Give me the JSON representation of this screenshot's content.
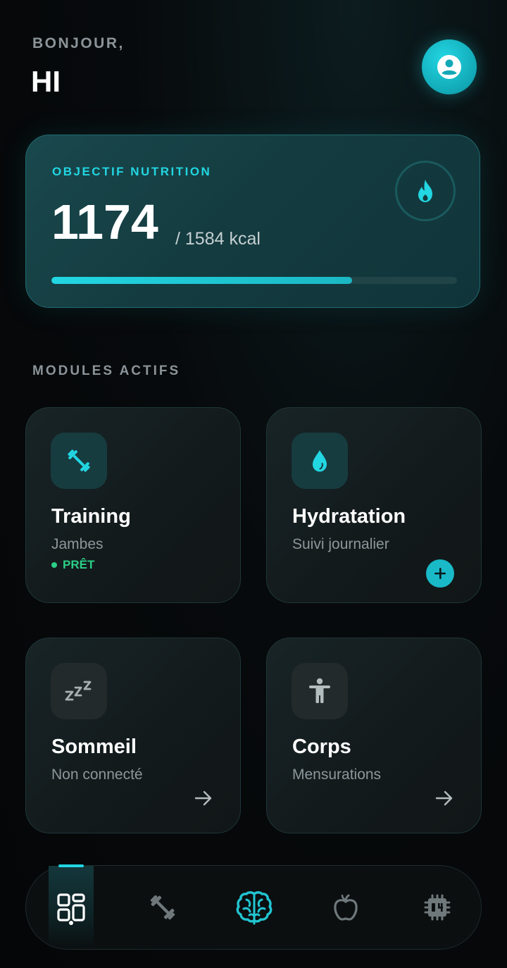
{
  "header": {
    "greeting": "BONJOUR,",
    "name": "HI",
    "avatar_icon": "user-icon"
  },
  "nutrition": {
    "title": "OBJECTIF NUTRITION",
    "current": "1174",
    "target_text": "/ 1584 kcal",
    "current_value": 1174,
    "target_value": 1584,
    "icon": "flame-icon",
    "accent_color": "#22d6e2"
  },
  "modules": {
    "section_label": "MODULES ACTIFS",
    "items": [
      {
        "title": "Training",
        "subtitle": "Jambes",
        "status": "PRÊT",
        "icon": "dumbbell-icon",
        "status_color": "#2bcf85"
      },
      {
        "title": "Hydratation",
        "subtitle": "Suivi journalier",
        "icon": "water-drop-icon",
        "action": "add-icon"
      },
      {
        "title": "Sommeil",
        "subtitle": "Non connecté",
        "icon": "sleep-zzz-icon",
        "action": "arrow-right-icon"
      },
      {
        "title": "Corps",
        "subtitle": "Mensurations",
        "icon": "body-icon",
        "action": "arrow-right-icon"
      }
    ]
  },
  "bottom_nav": {
    "items": [
      {
        "icon": "dashboard-grid-icon",
        "active": true
      },
      {
        "icon": "dumbbell-icon",
        "active": false
      },
      {
        "icon": "brain-icon",
        "active": false
      },
      {
        "icon": "apple-icon",
        "active": false
      },
      {
        "icon": "chip-icon",
        "active": false
      }
    ]
  }
}
